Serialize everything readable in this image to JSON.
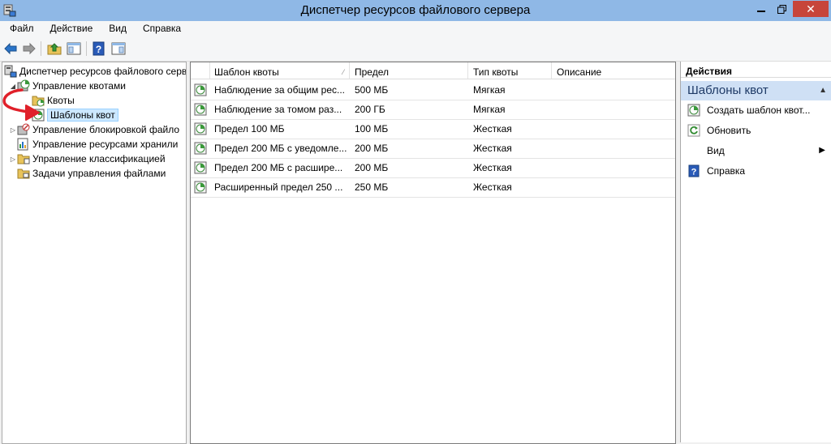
{
  "window": {
    "title": "Диспетчер ресурсов файлового сервера",
    "close_glyph": "✕"
  },
  "menu": [
    "Файл",
    "Действие",
    "Вид",
    "Справка"
  ],
  "toolbar": {
    "icons": [
      "back-icon",
      "forward-icon",
      "up-folder-icon",
      "show-hide-tree-icon",
      "help-icon",
      "show-hide-action-pane-icon"
    ]
  },
  "tree": {
    "root": "Диспетчер ресурсов файлового сервер",
    "quota_management": "Управление квотами",
    "quotas": "Квоты",
    "quota_templates": "Шаблоны квот",
    "file_screening": "Управление блокировкой файло",
    "storage_reports": "Управление ресурсами хранили",
    "classification": "Управление классификацией",
    "file_management": "Задачи управления файлами"
  },
  "list": {
    "columns": [
      "Шаблон квоты",
      "Предел",
      "Тип квоты",
      "Описание"
    ],
    "rows": [
      {
        "name": "Наблюдение за общим рес...",
        "limit": "500 МБ",
        "type": "Мягкая",
        "description": ""
      },
      {
        "name": "Наблюдение за томом раз...",
        "limit": "200 ГБ",
        "type": "Мягкая",
        "description": ""
      },
      {
        "name": "Предел 100 МБ",
        "limit": "100 МБ",
        "type": "Жесткая",
        "description": ""
      },
      {
        "name": "Предел 200 МБ с уведомле...",
        "limit": "200 МБ",
        "type": "Жесткая",
        "description": ""
      },
      {
        "name": "Предел 200 МБ с расшире...",
        "limit": "200 МБ",
        "type": "Жесткая",
        "description": ""
      },
      {
        "name": "Расширенный предел 250 ...",
        "limit": "250 МБ",
        "type": "Жесткая",
        "description": ""
      }
    ]
  },
  "actions": {
    "title": "Действия",
    "section": "Шаблоны квот",
    "items": [
      "Создать шаблон квот...",
      "Обновить",
      "Вид",
      "Справка"
    ]
  },
  "colors": {
    "title_bar": "#8fb8e6",
    "close_button": "#c7453a",
    "selection": "#cce8ff",
    "action_section": "#cfe0f5",
    "annotation_arrow": "#e0202a"
  }
}
